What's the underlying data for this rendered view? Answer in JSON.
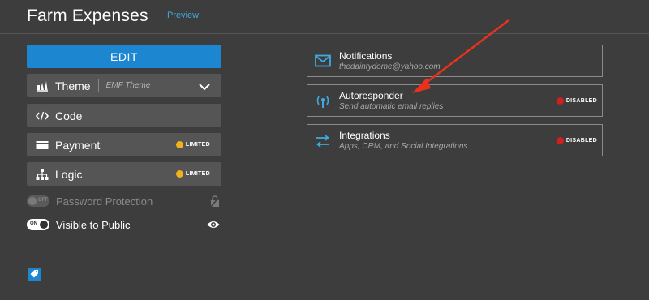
{
  "header": {
    "title": "Farm Expenses",
    "preview_label": "Preview"
  },
  "sidebar": {
    "edit_label": "EDIT",
    "theme": {
      "label": "Theme",
      "value": "EMF Theme"
    },
    "code": {
      "label": "Code"
    },
    "payment": {
      "label": "Payment",
      "badge": "LIMITED"
    },
    "logic": {
      "label": "Logic",
      "badge": "LIMITED"
    },
    "password_protection": {
      "label": "Password Protection",
      "state": "OFF"
    },
    "visible_to_public": {
      "label": "Visible to Public",
      "state": "ON"
    }
  },
  "cards": [
    {
      "title": "Notifications",
      "description": "thedaintydome@yahoo.com",
      "icon": "envelope-icon"
    },
    {
      "title": "Autoresponder",
      "description": "Send automatic email replies",
      "badge": "DISABLED",
      "icon": "broadcast-icon"
    },
    {
      "title": "Integrations",
      "description": "Apps, CRM, and Social Integrations",
      "badge": "DISABLED",
      "icon": "swap-arrows-icon"
    }
  ],
  "colors": {
    "background": "#3d3d3d",
    "accent": "#1c86d1",
    "link": "#3fa9e0",
    "limited": "#f0b31d",
    "disabled": "#d01f1f",
    "annotation_arrow": "#e8321e"
  }
}
